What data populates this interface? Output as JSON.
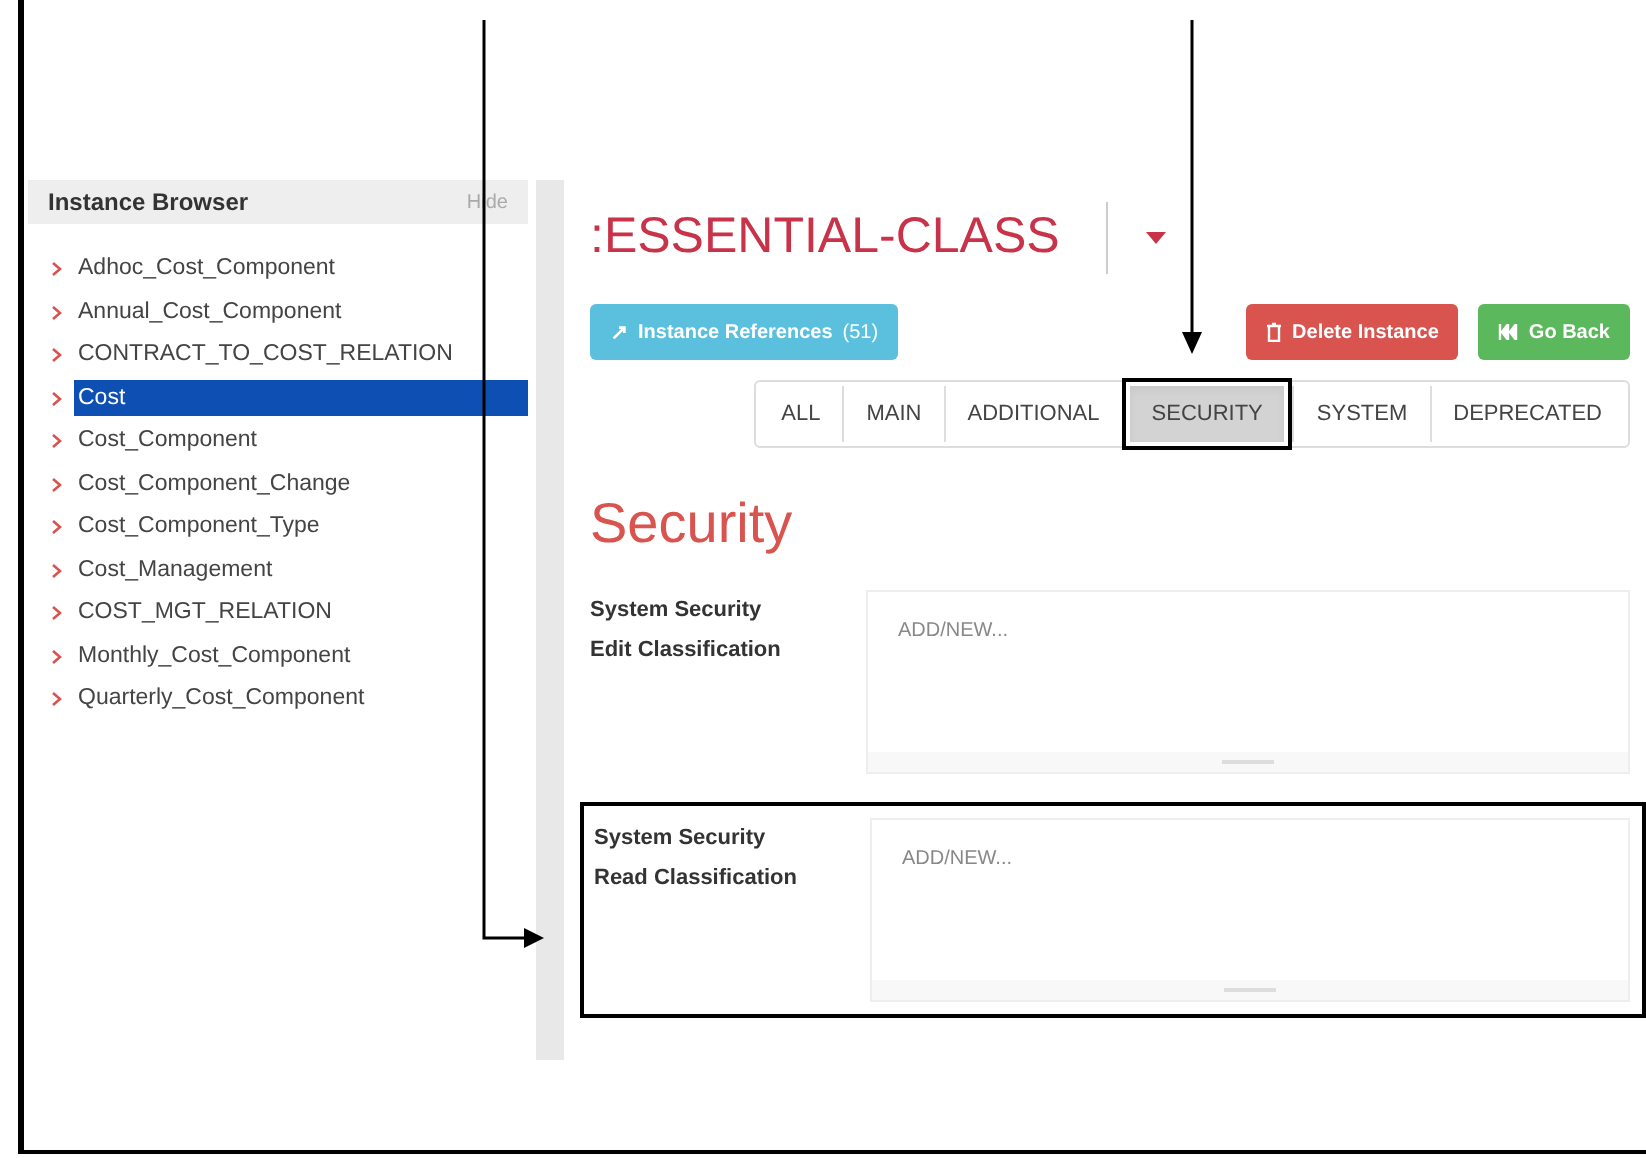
{
  "sidebar": {
    "title": "Instance Browser",
    "hide_label": "Hide",
    "items": [
      {
        "label": "Adhoc_Cost_Component",
        "selected": false
      },
      {
        "label": "Annual_Cost_Component",
        "selected": false
      },
      {
        "label": "CONTRACT_TO_COST_RELATION",
        "selected": false
      },
      {
        "label": "Cost",
        "selected": true
      },
      {
        "label": "Cost_Component",
        "selected": false
      },
      {
        "label": "Cost_Component_Change",
        "selected": false
      },
      {
        "label": "Cost_Component_Type",
        "selected": false
      },
      {
        "label": "Cost_Management",
        "selected": false
      },
      {
        "label": "COST_MGT_RELATION",
        "selected": false
      },
      {
        "label": "Monthly_Cost_Component",
        "selected": false
      },
      {
        "label": "Quarterly_Cost_Component",
        "selected": false
      }
    ]
  },
  "header": {
    "title": ":ESSENTIAL-CLASS"
  },
  "buttons": [
    {
      "kind": "references",
      "label": "Instance References",
      "count": "(51)"
    },
    {
      "kind": "delete",
      "label": "Delete Instance"
    },
    {
      "kind": "back",
      "label": "Go Back"
    }
  ],
  "tabs": [
    {
      "label": "ALL",
      "selected": false,
      "highlighted": false
    },
    {
      "label": "MAIN",
      "selected": false,
      "highlighted": false
    },
    {
      "label": "ADDITIONAL",
      "selected": false,
      "highlighted": false
    },
    {
      "label": "SECURITY",
      "selected": true,
      "highlighted": true
    },
    {
      "label": "SYSTEM",
      "selected": false,
      "highlighted": false
    },
    {
      "label": "DEPRECATED",
      "selected": false,
      "highlighted": false
    }
  ],
  "section_title": "Security",
  "fields": [
    {
      "label": "System Security Edit Classification",
      "placeholder": "ADD/NEW...",
      "highlighted": false
    },
    {
      "label": "System Security Read Classification",
      "placeholder": "ADD/NEW...",
      "highlighted": true
    }
  ]
}
